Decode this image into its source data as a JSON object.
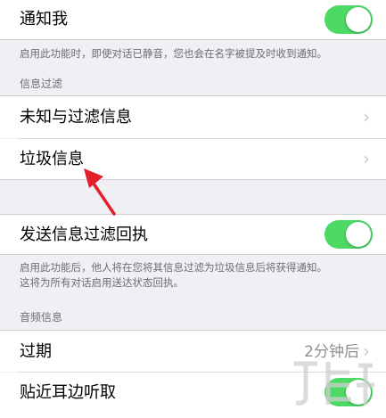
{
  "notify": {
    "label": "通知我",
    "on": true
  },
  "notify_footer": "启用此功能时，即使对话已静音，您也会在名字被提及时收到通知。",
  "filter_header": "信息过滤",
  "filter_items": [
    {
      "label": "未知与过滤信息"
    },
    {
      "label": "垃圾信息"
    }
  ],
  "receipt": {
    "label": "发送信息过滤回执",
    "on": true
  },
  "receipt_footer": [
    "启用此功能后，他人将在您将其信息过滤为垃圾信息后将获得通知。",
    "这将为所有对话启用送达状态回执。"
  ],
  "audio_header": "音频信息",
  "expire": {
    "label": "过期",
    "value": "2分钟后"
  },
  "raise": {
    "label": "贴近耳边听取",
    "on": true
  },
  "colors": {
    "toggle_on": "#4cd964",
    "arrow": "#e2202a",
    "background": "#efeff4"
  },
  "icons": {
    "chevron": "chevron-right-icon",
    "arrow": "red-pointer-arrow"
  }
}
